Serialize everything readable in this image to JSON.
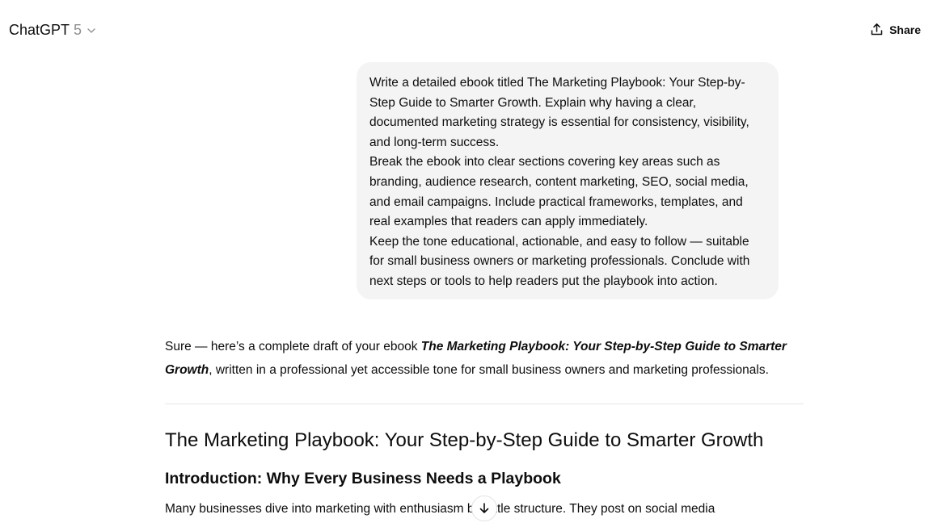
{
  "header": {
    "model_name": "ChatGPT",
    "model_version": "5",
    "share_label": "Share",
    "icons": {
      "model_menu": "chevron-down-icon",
      "share": "share-icon"
    }
  },
  "conversation": {
    "user_message": [
      "Write a detailed ebook titled The Marketing Playbook: Your Step-by-Step Guide to Smarter Growth. Explain why having a clear, documented marketing strategy is essential for consistency, visibility, and long-term success.",
      "Break the ebook into clear sections covering key areas such as branding, audience research, content marketing, SEO, social media, and email campaigns. Include practical frameworks, templates, and real examples that readers can apply immediately.",
      "Keep the tone educational, actionable, and easy to follow — suitable for small business owners or marketing professionals. Conclude with next steps or tools to help readers put the playbook into action."
    ],
    "assistant": {
      "intro_before": "Sure — here’s a complete draft of your ebook ",
      "intro_title": "The Marketing Playbook: Your Step-by-Step Guide to Smarter Growth",
      "intro_after": ", written in a professional yet accessible tone for small business owners and marketing professionals.",
      "heading": "The Marketing Playbook: Your Step-by-Step Guide to Smarter Growth",
      "subheading": "Introduction: Why Every Business Needs a Playbook",
      "paragraph_start": "Many businesses dive into marketing with enthusiasm but little structure. They post on social media"
    }
  },
  "scroll_button_icon": "arrow-down-icon"
}
